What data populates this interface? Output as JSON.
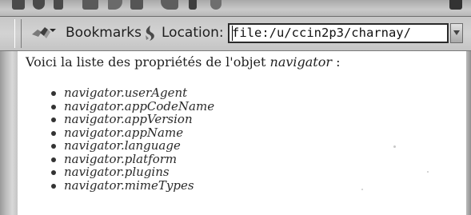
{
  "toolbar": {
    "icons": [
      "back-icon",
      "forward-icon",
      "reload-icon",
      "home-icon",
      "search-icon",
      "netscape-icon",
      "print-icon",
      "security-icon",
      "stop-icon",
      "throbber-icon"
    ]
  },
  "location_bar": {
    "bookmarks_label": "Bookmarks",
    "location_label": "Location:",
    "url_value": "file:/u/ccin2p3/charnay/"
  },
  "page": {
    "intro_prefix": "Voici la liste des propriétés de l'objet ",
    "intro_object": "navigator",
    "intro_suffix": " :",
    "properties": [
      "navigator.userAgent",
      "navigator.appCodeName",
      "navigator.appVersion",
      "navigator.appName",
      "navigator.language",
      "navigator.platform",
      "navigator.plugins",
      "navigator.mimeTypes"
    ]
  }
}
